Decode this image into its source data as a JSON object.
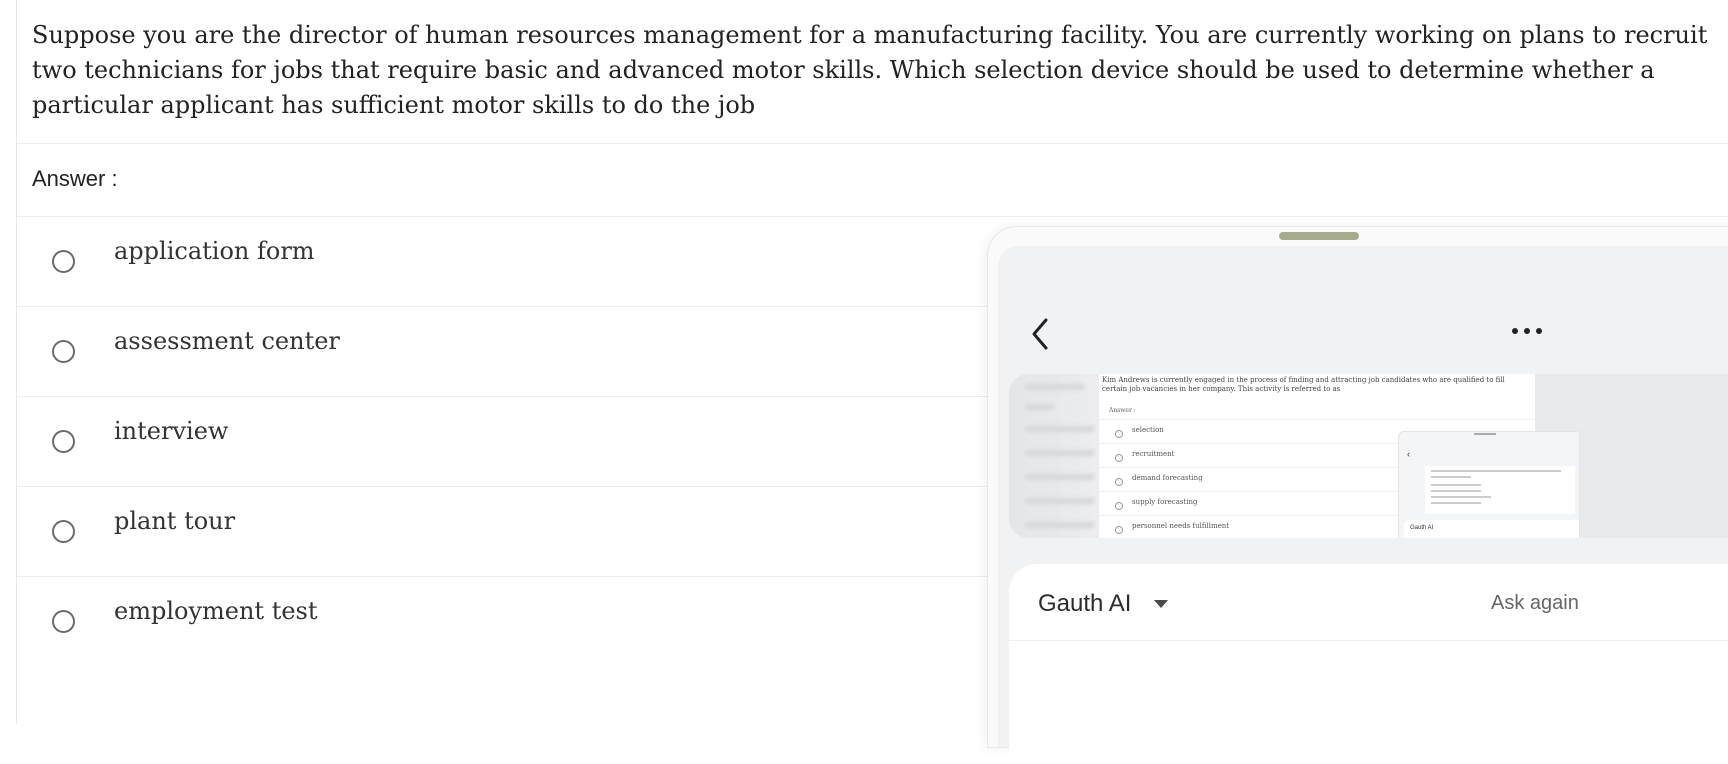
{
  "question": "Suppose you are the director of human resources management for a manufacturing facility. You are currently working on plans to recruit two technicians for jobs that require basic and advanced motor skills. Which selection device should be used to determine whether a particular applicant has sufficient motor skills to do the job",
  "answer_label": "Answer :",
  "options": [
    {
      "label": "application form"
    },
    {
      "label": "assessment center"
    },
    {
      "label": "interview"
    },
    {
      "label": "plant tour"
    },
    {
      "label": "employment test"
    }
  ],
  "overlay": {
    "back_icon": "chevron-left-icon",
    "more_icon": "more-horizontal-icon",
    "thumbnail": {
      "question": "Kim Andrews is currently engaged in the process of finding and attracting job candidates who are qualified to fill certain job vacancies in her company. This activity is referred to as",
      "answer_label": "Answer :",
      "options": [
        "selection",
        "recruitment",
        "demand forecasting",
        "supply forecasting",
        "personnel needs fulfillment"
      ],
      "mini_title": "Gauth AI"
    },
    "ai_title": "Gauth AI",
    "ask_again": "Ask again"
  },
  "colors": {
    "handle": "#a7ab8d",
    "panel_bg": "#f1f2f4",
    "divider": "#ececec"
  }
}
